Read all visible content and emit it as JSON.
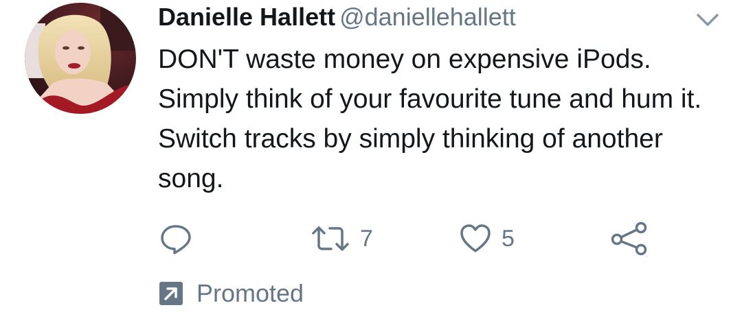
{
  "tweet": {
    "author_name": "Danielle Hallett",
    "author_handle": "@daniellehallett",
    "text": "DON'T waste money on expensive iPods. Simply think of your favourite tune and hum it. Switch tracks by simply thinking of another song.",
    "avatar_icon": "profile-photo",
    "menu_icon": "chevron-down-icon"
  },
  "actions": {
    "reply": {
      "icon": "reply-icon",
      "count": ""
    },
    "retweet": {
      "icon": "retweet-icon",
      "count": "7"
    },
    "like": {
      "icon": "heart-icon",
      "count": "5"
    },
    "share": {
      "icon": "share-icon"
    }
  },
  "promoted": {
    "label": "Promoted",
    "icon": "promoted-arrow-icon"
  },
  "colors": {
    "text_primary": "#14171a",
    "text_secondary": "#657786",
    "background": "#ffffff"
  }
}
